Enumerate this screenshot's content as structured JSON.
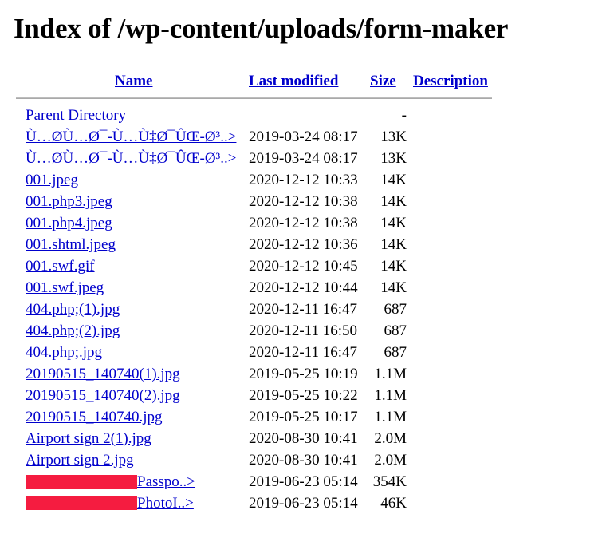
{
  "page": {
    "title": "Index of /wp-content/uploads/form-maker",
    "link_color": "#0000cc",
    "redaction_color": "#f51c40",
    "rule_color": "#a9a9a9"
  },
  "columns": {
    "name": "Name",
    "last_modified": "Last modified",
    "size": "Size",
    "description": "Description"
  },
  "parent": {
    "label": "Parent Directory",
    "last_modified": "",
    "size": "-",
    "description": ""
  },
  "rows": [
    {
      "name": "Ù…ØÙ…Ø¯-Ù…Ù‡Ø¯ÛŒ-Ø³..>",
      "last_modified": "2019-03-24 08:17",
      "size": "13K",
      "description": "",
      "redacted": false
    },
    {
      "name": "Ù…ØÙ…Ø¯-Ù…Ù‡Ø¯ÛŒ-Ø³..>",
      "last_modified": "2019-03-24 08:17",
      "size": "13K",
      "description": "",
      "redacted": false
    },
    {
      "name": "001.jpeg",
      "last_modified": "2020-12-12 10:33",
      "size": "14K",
      "description": "",
      "redacted": false
    },
    {
      "name": "001.php3.jpeg",
      "last_modified": "2020-12-12 10:38",
      "size": "14K",
      "description": "",
      "redacted": false
    },
    {
      "name": "001.php4.jpeg",
      "last_modified": "2020-12-12 10:38",
      "size": "14K",
      "description": "",
      "redacted": false
    },
    {
      "name": "001.shtml.jpeg",
      "last_modified": "2020-12-12 10:36",
      "size": "14K",
      "description": "",
      "redacted": false
    },
    {
      "name": "001.swf.gif",
      "last_modified": "2020-12-12 10:45",
      "size": "14K",
      "description": "",
      "redacted": false
    },
    {
      "name": "001.swf.jpeg",
      "last_modified": "2020-12-12 10:44",
      "size": "14K",
      "description": "",
      "redacted": false
    },
    {
      "name": "404.php;(1).jpg",
      "last_modified": "2020-12-11 16:47",
      "size": "687",
      "description": "",
      "redacted": false
    },
    {
      "name": "404.php;(2).jpg",
      "last_modified": "2020-12-11 16:50",
      "size": "687",
      "description": "",
      "redacted": false
    },
    {
      "name": "404.php;.jpg",
      "last_modified": "2020-12-11 16:47",
      "size": "687",
      "description": "",
      "redacted": false
    },
    {
      "name": "20190515_140740(1).jpg",
      "last_modified": "2019-05-25 10:19",
      "size": "1.1M",
      "description": "",
      "redacted": false
    },
    {
      "name": "20190515_140740(2).jpg",
      "last_modified": "2019-05-25 10:22",
      "size": "1.1M",
      "description": "",
      "redacted": false
    },
    {
      "name": "20190515_140740.jpg",
      "last_modified": "2019-05-25 10:17",
      "size": "1.1M",
      "description": "",
      "redacted": false
    },
    {
      "name": "Airport sign 2(1).jpg",
      "last_modified": "2020-08-30 10:41",
      "size": "2.0M",
      "description": "",
      "redacted": false
    },
    {
      "name": "Airport sign 2.jpg",
      "last_modified": "2020-08-30 10:41",
      "size": "2.0M",
      "description": "",
      "redacted": false
    },
    {
      "name": "Passpo..>",
      "last_modified": "2019-06-23 05:14",
      "size": "354K",
      "description": "",
      "redacted": true
    },
    {
      "name": "PhotoI..>",
      "last_modified": "2019-06-23 05:14",
      "size": "46K",
      "description": "",
      "redacted": true
    }
  ]
}
